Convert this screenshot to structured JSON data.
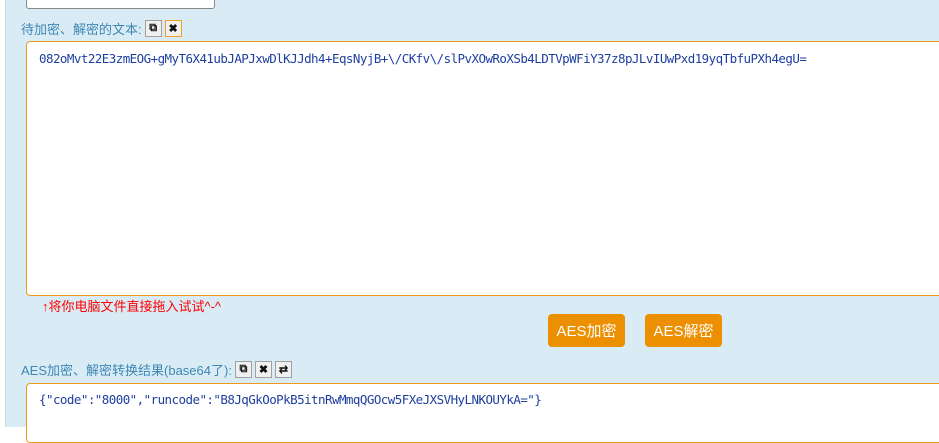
{
  "input": {
    "label": "待加密、解密的文本:",
    "value": "082oMvt22E3zmEOG+gMyT6X41ubJAPJxwDlKJJdh4+EqsNyjB+\\/CKfv\\/slPvXOwRoXSb4LDTVpWFiY37z8pJLvIUwPxd19yqTbfuPXh4egU=",
    "copy_icon": "copy-icon",
    "clear_icon": "close-icon"
  },
  "tip": "↑将你电脑文件直接拖入试试^-^",
  "buttons": {
    "encrypt": "AES加密",
    "decrypt": "AES解密"
  },
  "output": {
    "label": "AES加密、解密转换结果(base64了):",
    "value": "{\"code\":\"8000\",\"runcode\":\"B8JqGkOoPkB5itnRwMmqQGOcw5FXeJXSVHyLNKOUYkA=\"}"
  },
  "colors": {
    "accent": "#ec8f00",
    "panel": "#d9ecf5",
    "label": "#3e87b4"
  }
}
